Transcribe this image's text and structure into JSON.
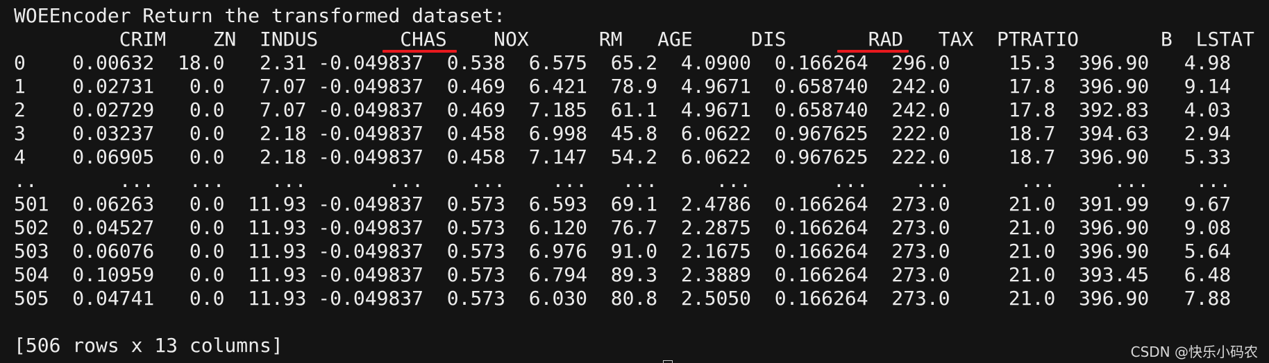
{
  "terminal": {
    "header": "WOEEncoder Return the transformed dataset:",
    "columns_line": "         CRIM    ZN  INDUS       CHAS    NOX      RM   AGE     DIS       RAD   TAX  PTRATIO       B  LSTAT",
    "rows": [
      "0    0.00632  18.0   2.31 -0.049837  0.538  6.575  65.2  4.0900  0.166264  296.0     15.3  396.90   4.98",
      "1    0.02731   0.0   7.07 -0.049837  0.469  6.421  78.9  4.9671  0.658740  242.0     17.8  396.90   9.14",
      "2    0.02729   0.0   7.07 -0.049837  0.469  7.185  61.1  4.9671  0.658740  242.0     17.8  392.83   4.03",
      "3    0.03237   0.0   2.18 -0.049837  0.458  6.998  45.8  6.0622  0.967625  222.0     18.7  394.63   2.94",
      "4    0.06905   0.0   2.18 -0.049837  0.458  7.147  54.2  6.0622  0.967625  222.0     18.7  396.90   5.33",
      "..       ...   ...    ...       ...    ...    ...   ...     ...       ...    ...      ...     ...    ...",
      "501  0.06263   0.0  11.93 -0.049837  0.573  6.593  69.1  2.4786  0.166264  273.0     21.0  391.99   9.67",
      "502  0.04527   0.0  11.93 -0.049837  0.573  6.120  76.7  2.2875  0.166264  273.0     21.0  396.90   9.08",
      "503  0.06076   0.0  11.93 -0.049837  0.573  6.976  91.0  2.1675  0.166264  273.0     21.0  396.90   5.64",
      "504  0.10959   0.0  11.93 -0.049837  0.573  6.794  89.3  2.3889  0.166264  273.0     21.0  393.45   6.48",
      "505  0.04741   0.0  11.93 -0.049837  0.573  6.030  80.8  2.5050  0.166264  273.0     21.0  396.90   7.88"
    ],
    "blank": "",
    "summary": "[506 rows x 13 columns]"
  },
  "highlighted_columns": [
    "CHAS",
    "RAD"
  ],
  "watermark": "CSDN @快乐小码农",
  "colors": {
    "background": "#141414",
    "text": "#ececec",
    "underline": "#e8191e"
  }
}
